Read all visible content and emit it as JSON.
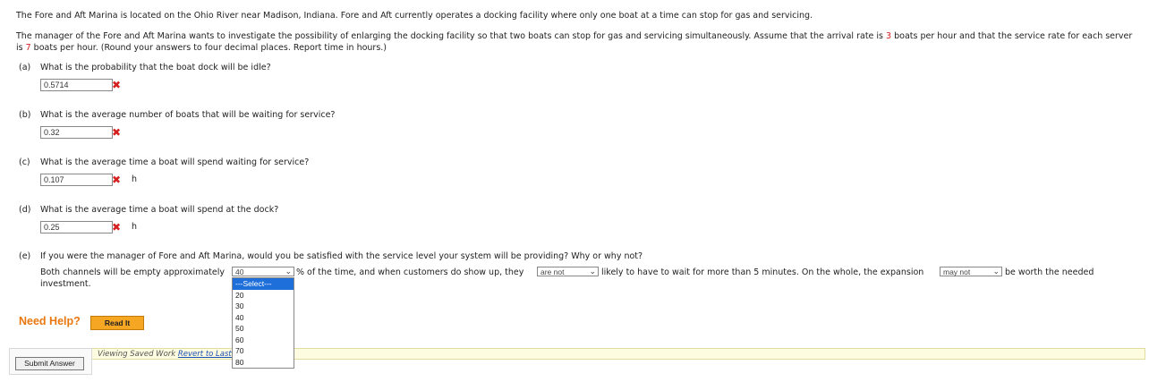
{
  "intro": "The Fore and Aft Marina is located on the Ohio River near Madison, Indiana. Fore and Aft currently operates a docking facility where only one boat at a time can stop for gas and servicing.",
  "para2": {
    "before_arrival": "The manager of the Fore and Aft Marina wants to investigate the possibility of enlarging the docking facility so that two boats can stop for gas and servicing simultaneously. Assume that the arrival rate is ",
    "arrival_rate": "3",
    "between": " boats per hour and that the service rate for each server is ",
    "service_rate": "7",
    "after": " boats per hour. (Round your answers to four decimal places. Report time in hours.)"
  },
  "questions": {
    "a": {
      "label": "(a)",
      "text": "What is the probability that the boat dock will be idle?",
      "value": "0.5714",
      "unit": ""
    },
    "b": {
      "label": "(b)",
      "text": "What is the average number of boats that will be waiting for service?",
      "value": "0.32",
      "unit": ""
    },
    "c": {
      "label": "(c)",
      "text": "What is the average time a boat will spend waiting for service?",
      "value": "0.107",
      "unit": "h"
    },
    "d": {
      "label": "(d)",
      "text": "What is the average time a boat will spend at the dock?",
      "value": "0.25",
      "unit": "h"
    },
    "e": {
      "label": "(e)",
      "text": "If you were the manager of Fore and Aft Marina, would you be satisfied with the service level your system will be providing? Why or why not?",
      "s1": "Both channels will be empty approximately",
      "select1_value": "40",
      "s2": "% of the time, and when customers do show up, they",
      "select2_value": "are not",
      "s3": "likely to have to wait for more than 5 minutes. On the whole, the expansion",
      "select3_value": "may not",
      "s4": "be worth the needed",
      "s5": "investment."
    }
  },
  "dropdown_options": [
    "---Select---",
    "20",
    "30",
    "40",
    "50",
    "60",
    "70",
    "80"
  ],
  "need_help": "Need Help?",
  "read_it": "Read It",
  "saved_text": "Viewing Saved Work ",
  "revert_link": "Revert to Last Re",
  "submit": "Submit Answer",
  "colors": {
    "error": "#d62020",
    "help": "#e8770e",
    "readit": "#f5a623",
    "highlight": "#1e6fd9"
  }
}
